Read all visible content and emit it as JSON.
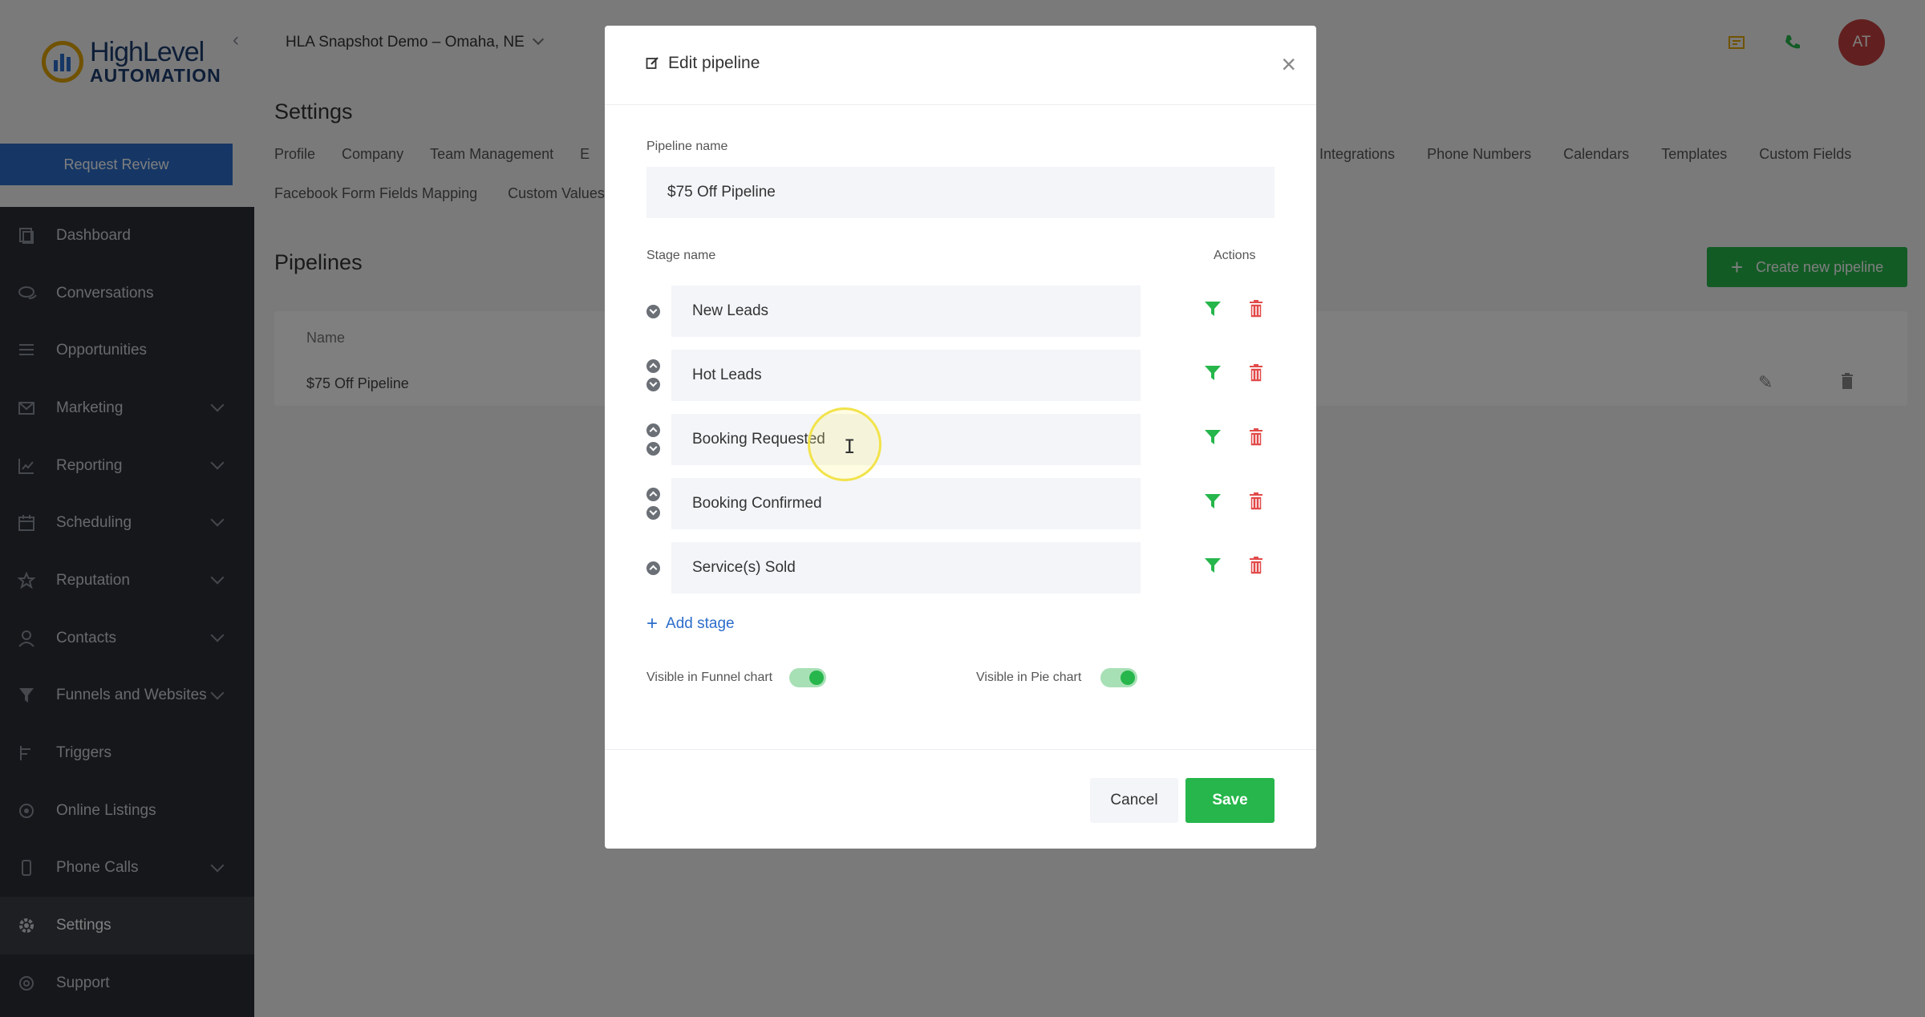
{
  "app": {
    "location": "HLA Snapshot Demo – Omaha, NE",
    "logo_line1": "HighLevel",
    "logo_line2": "AUTOMATION",
    "request_review": "Request Review",
    "avatar_initials": "AT"
  },
  "sidebar": {
    "items": [
      {
        "label": "Dashboard",
        "icon": "dashboard-icon"
      },
      {
        "label": "Conversations",
        "icon": "chat-icon"
      },
      {
        "label": "Opportunities",
        "icon": "list-icon"
      },
      {
        "label": "Marketing",
        "icon": "mail-icon"
      },
      {
        "label": "Reporting",
        "icon": "chart-icon"
      },
      {
        "label": "Scheduling",
        "icon": "calendar-icon"
      },
      {
        "label": "Reputation",
        "icon": "star-icon"
      },
      {
        "label": "Contacts",
        "icon": "person-icon"
      },
      {
        "label": "Funnels and Websites",
        "icon": "funnel-icon"
      },
      {
        "label": "Triggers",
        "icon": "trigger-icon"
      },
      {
        "label": "Online Listings",
        "icon": "listing-icon"
      },
      {
        "label": "Phone Calls",
        "icon": "phone-icon"
      },
      {
        "label": "Settings",
        "icon": "gear-icon"
      },
      {
        "label": "Support",
        "icon": "support-icon"
      }
    ]
  },
  "settings": {
    "title": "Settings",
    "tabs_row1_left": [
      "Profile",
      "Company",
      "Team Management",
      "E"
    ],
    "tabs_row1_right": [
      "Integrations",
      "Phone Numbers",
      "Calendars",
      "Templates",
      "Custom Fields"
    ],
    "tabs_row2": [
      "Facebook Form Fields Mapping",
      "Custom Values"
    ]
  },
  "pipelines": {
    "title": "Pipelines",
    "create_button": "Create new pipeline",
    "column_name": "Name",
    "rows": [
      "$75 Off Pipeline"
    ]
  },
  "modal": {
    "title": "Edit pipeline",
    "pipeline_name_label": "Pipeline name",
    "pipeline_name_value": "$75 Off Pipeline",
    "stage_name_label": "Stage name",
    "actions_label": "Actions",
    "stages": [
      "New Leads",
      "Hot Leads",
      "Booking Requested",
      "Booking Confirmed",
      "Service(s) Sold"
    ],
    "add_stage": "Add stage",
    "funnel_toggle_label": "Visible in Funnel chart",
    "pie_toggle_label": "Visible in Pie chart",
    "cancel": "Cancel",
    "save": "Save"
  },
  "colors": {
    "primary": "#2c6ecb",
    "success": "#26b64b",
    "danger": "#e24a4a",
    "sidebar": "#2b2f36"
  }
}
